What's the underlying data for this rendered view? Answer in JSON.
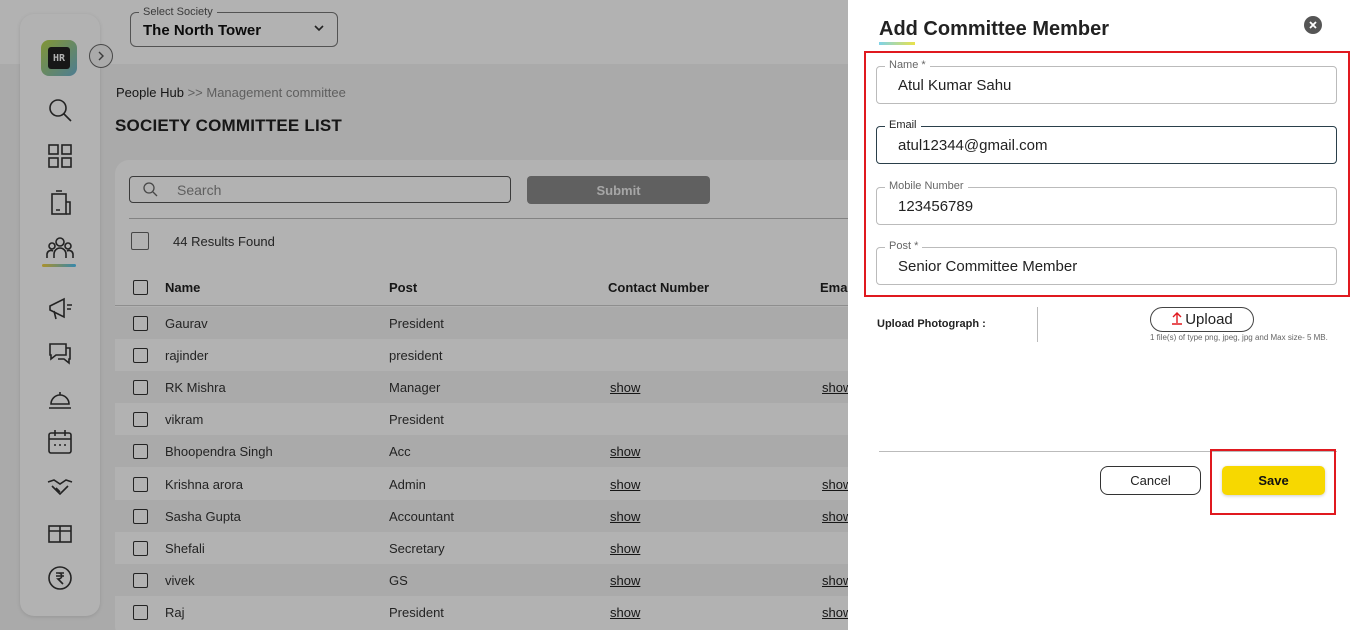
{
  "society_select": {
    "label": "Select Society",
    "value": "The North Tower"
  },
  "logo_text": "HR",
  "breadcrumb": {
    "first": "People Hub",
    "separator": " >> ",
    "current": "Management committee"
  },
  "page_title": "SOCIETY COMMITTEE LIST",
  "search": {
    "placeholder": "Search",
    "submit_label": "Submit"
  },
  "results_text": "44 Results Found",
  "table": {
    "headers": {
      "name": "Name",
      "post": "Post",
      "contact": "Contact Number",
      "email": "Ema"
    },
    "rows": [
      {
        "name": "Gaurav",
        "post": "President",
        "contact": "",
        "email": ""
      },
      {
        "name": "rajinder",
        "post": "president",
        "contact": "",
        "email": ""
      },
      {
        "name": "RK Mishra",
        "post": "Manager",
        "contact": "show",
        "email": "show"
      },
      {
        "name": "vikram",
        "post": "President",
        "contact": "",
        "email": ""
      },
      {
        "name": "Bhoopendra Singh",
        "post": "Acc",
        "contact": "show",
        "email": ""
      },
      {
        "name": "Krishna arora",
        "post": "Admin",
        "contact": "show",
        "email": "show"
      },
      {
        "name": "Sasha Gupta",
        "post": "Accountant",
        "contact": "show",
        "email": "show"
      },
      {
        "name": "Shefali",
        "post": "Secretary",
        "contact": "show",
        "email": ""
      },
      {
        "name": "vivek",
        "post": "GS",
        "contact": "show",
        "email": "show"
      },
      {
        "name": "Raj",
        "post": "President",
        "contact": "show",
        "email": "show"
      }
    ]
  },
  "drawer": {
    "title": "Add Committee Member",
    "close_icon": "close-icon",
    "fields": {
      "name": {
        "label": "Name *",
        "value": "Atul Kumar Sahu"
      },
      "email": {
        "label": "Email",
        "value": "atul12344@gmail.com"
      },
      "mobile": {
        "label": "Mobile Number",
        "value": "123456789"
      },
      "post": {
        "label": "Post *",
        "value": "Senior Committee Member"
      }
    },
    "upload": {
      "label": "Upload Photograph :",
      "button_label": "Upload",
      "note": "1 file(s) of type png, jpeg, jpg and Max size- 5 MB."
    },
    "cancel_label": "Cancel",
    "save_label": "Save"
  },
  "colors": {
    "save_yellow": "#f7d800",
    "highlight_red": "#e0191f",
    "overlay": "rgba(0,0,0,0.30)"
  }
}
